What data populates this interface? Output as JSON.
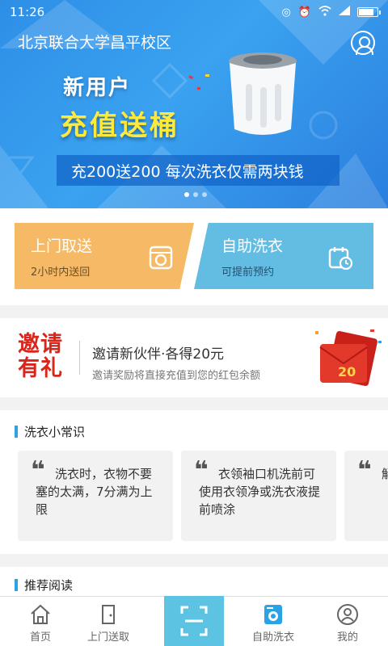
{
  "status_bar": {
    "time": "11:26"
  },
  "header": {
    "campus": "北京联合大学昌平校区"
  },
  "banner": {
    "line1": "新用户",
    "line2": "充值送桶",
    "strip": "充200送200  每次洗衣仅需两块钱",
    "page_count": 3,
    "active_page": 1
  },
  "services": [
    {
      "title": "上门取送",
      "subtitle": "2小时内送回",
      "icon": "washing-machine-icon",
      "color": "#f6b966"
    },
    {
      "title": "自助洗衣",
      "subtitle": "可提前预约",
      "icon": "calendar-clock-icon",
      "color": "#63bde3"
    }
  ],
  "invite": {
    "logo_line1": "邀请",
    "logo_line2": "有礼",
    "title": "邀请新伙伴·各得20元",
    "subtitle": "邀请奖励将直接充值到您的红包余额",
    "badge": "20"
  },
  "tips": {
    "heading": "洗衣小常识",
    "cards": [
      {
        "text": "洗衣时，衣物不要塞的太满，7分满为上限"
      },
      {
        "text": "衣领袖口机洗前可使用衣领净或洗衣液提前喷涂"
      },
      {
        "text": "解"
      }
    ]
  },
  "reading": {
    "heading": "推荐阅读"
  },
  "bottom_nav": {
    "items": [
      {
        "label": "首页",
        "icon": "home-icon"
      },
      {
        "label": "上门送取",
        "icon": "door-icon"
      },
      {
        "label": "",
        "icon": "scan-icon"
      },
      {
        "label": "自助洗衣",
        "icon": "washing-machine-icon"
      },
      {
        "label": "我的",
        "icon": "user-icon"
      }
    ],
    "active": "自助洗衣"
  },
  "colors": {
    "accent": "#29a3e6",
    "banner_blue": "#2e8ee6",
    "pickup_orange": "#f6b966",
    "self_blue": "#63bde3",
    "invite_red": "#d9261c",
    "promo_yellow": "#ffe93b"
  }
}
